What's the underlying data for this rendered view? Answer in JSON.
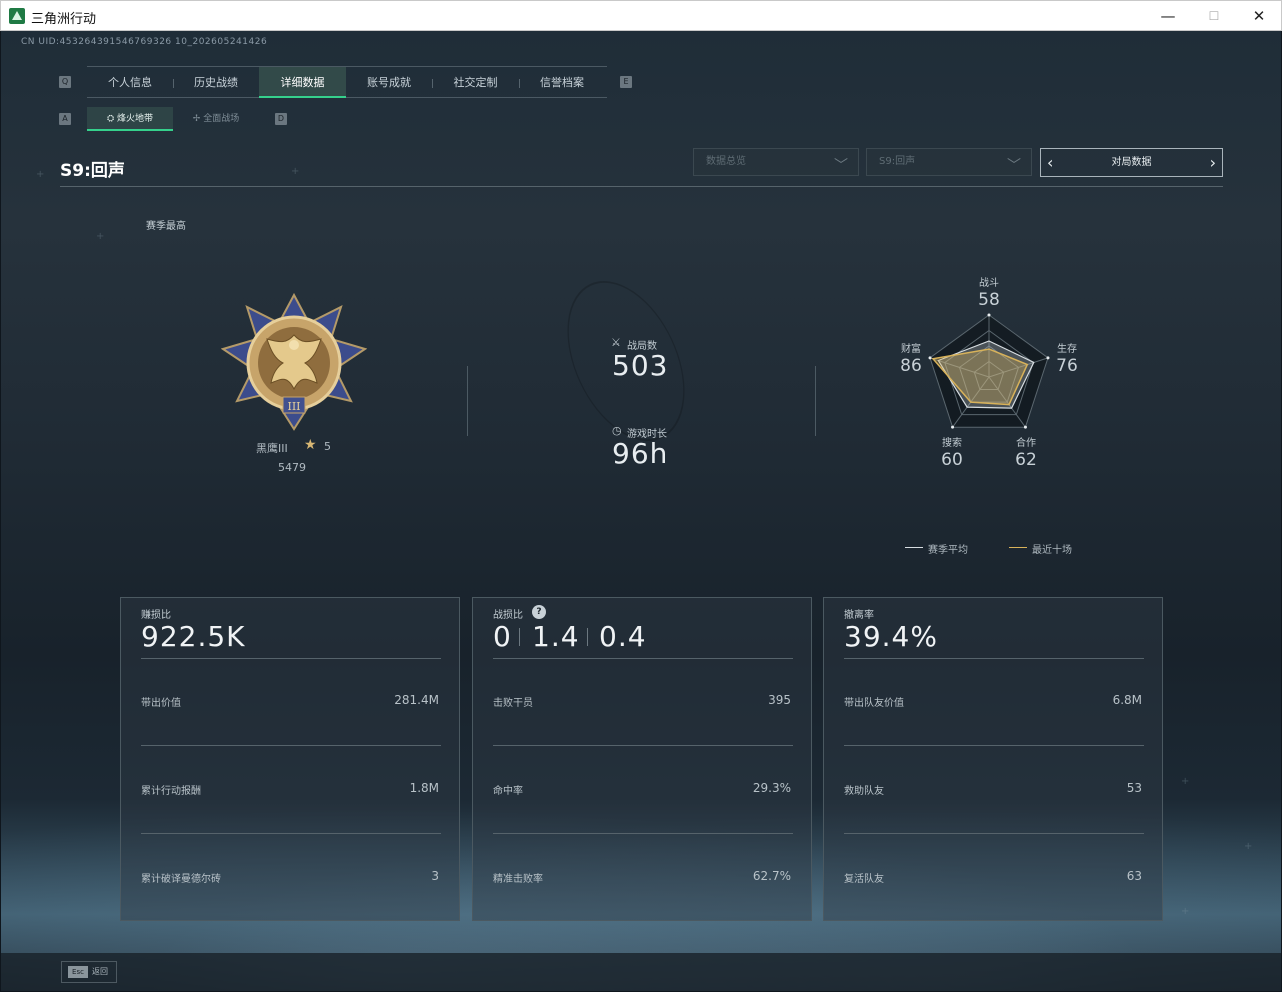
{
  "window": {
    "title": "三角洲行动",
    "minimize": "—",
    "maximize": "☐",
    "close": "✕"
  },
  "uid": "CN UID:453264391546769326 10_202605241426",
  "keys": {
    "tab_left": "Q",
    "tab_right": "E",
    "sub_left": "A",
    "sub_right": "D"
  },
  "tabs": [
    {
      "label": "个人信息",
      "active": false
    },
    {
      "label": "历史战绩",
      "active": false
    },
    {
      "label": "详细数据",
      "active": true
    },
    {
      "label": "账号成就",
      "active": false
    },
    {
      "label": "社交定制",
      "active": false
    },
    {
      "label": "信誉档案",
      "active": false
    }
  ],
  "subtabs": [
    {
      "label": "烽火地带",
      "active": true
    },
    {
      "label": "全面战场",
      "active": false
    }
  ],
  "season": {
    "title": "S9:回声"
  },
  "filters": {
    "data_scope": "数据总览",
    "season_select": "S9:回声",
    "match_data": "对局数据"
  },
  "season_best": "赛季最高",
  "rank": {
    "name": "黑鹰III",
    "stars": "5",
    "score": "5479",
    "star_icon": "star-icon",
    "emblem": "eagle-rank-emblem"
  },
  "summary": {
    "matches_label": "战局数",
    "matches": "503",
    "time_label": "游戏时长",
    "time": "96h"
  },
  "radar": {
    "labels": {
      "combat": "战斗",
      "survival": "生存",
      "cooperation": "合作",
      "search": "搜索",
      "wealth": "财富"
    },
    "values": {
      "combat": "58",
      "survival": "76",
      "cooperation": "62",
      "search": "60",
      "wealth": "86"
    },
    "season_avg": [
      58,
      76,
      62,
      60,
      86
    ],
    "recent_ten": [
      45,
      65,
      55,
      50,
      95
    ],
    "avg_color": "#d7dde1",
    "recent_color": "#d8b25a",
    "legend_avg": "赛季平均",
    "legend_recent": "最近十场"
  },
  "cards": {
    "profit": {
      "label": "赚损比",
      "value": "922.5K",
      "rows": [
        {
          "label": "带出价值",
          "value": "281.4M"
        },
        {
          "label": "累计行动报酬",
          "value": "1.8M"
        },
        {
          "label": "累计破译曼德尔砖",
          "value": "3"
        }
      ]
    },
    "kd": {
      "label": "战损比",
      "help": "?",
      "values": [
        "0",
        "1.4",
        "0.4"
      ],
      "rows": [
        {
          "label": "击败干员",
          "value": "395"
        },
        {
          "label": "命中率",
          "value": "29.3%"
        },
        {
          "label": "精准击败率",
          "value": "62.7%"
        }
      ]
    },
    "extract": {
      "label": "撤离率",
      "value": "39.4%",
      "rows": [
        {
          "label": "带出队友价值",
          "value": "6.8M"
        },
        {
          "label": "救助队友",
          "value": "53"
        },
        {
          "label": "复活队友",
          "value": "63"
        }
      ]
    }
  },
  "footer": {
    "esc_key": "Esc",
    "back": "返回"
  }
}
